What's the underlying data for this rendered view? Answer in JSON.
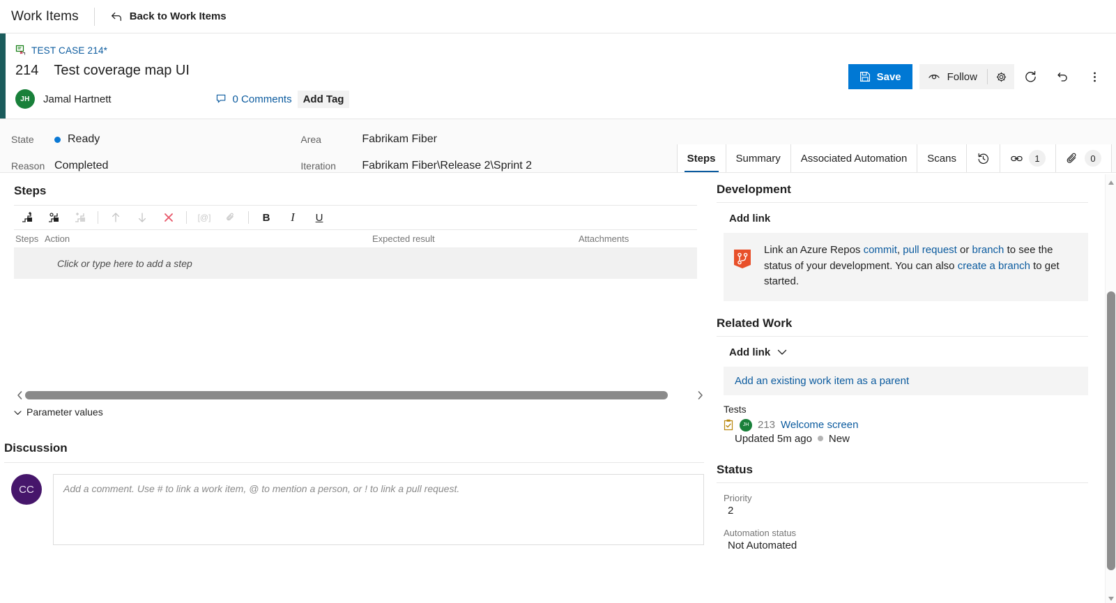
{
  "topbar": {
    "hub_title": "Work Items",
    "back_label": "Back to Work Items",
    "back_icon": "back-arrow-icon"
  },
  "work_item": {
    "type_breadcrumb": "TEST CASE 214*",
    "type_icon": "test-case-icon",
    "id": "214",
    "title": "Test coverage map UI",
    "assigned_to": "Jamal Hartnett",
    "assigned_to_initials": "JH",
    "comments_label": "0 Comments",
    "comments_icon": "comment-bubble-icon",
    "add_tag_label": "Add Tag"
  },
  "actions": {
    "save_label": "Save",
    "save_icon": "save-disk-icon",
    "follow_label": "Follow",
    "follow_icon": "eye-icon",
    "settings_icon": "gear-icon",
    "refresh_icon": "refresh-icon",
    "revert_icon": "undo-icon",
    "more_icon": "more-vertical-icon",
    "accent_color": "#0078d4"
  },
  "fields": {
    "state": {
      "label": "State",
      "value": "Ready",
      "dot_color": "#0a78d4"
    },
    "reason": {
      "label": "Reason",
      "value": "Completed"
    },
    "area": {
      "label": "Area",
      "value": "Fabrikam Fiber"
    },
    "iteration": {
      "label": "Iteration",
      "value": "Fabrikam Fiber\\Release 2\\Sprint 2"
    }
  },
  "tabs": [
    {
      "label": "Steps",
      "selected": true,
      "icon": "",
      "badge": ""
    },
    {
      "label": "Summary",
      "selected": false,
      "icon": "",
      "badge": ""
    },
    {
      "label": "Associated Automation",
      "selected": false,
      "icon": "",
      "badge": ""
    },
    {
      "label": "Scans",
      "selected": false,
      "icon": "",
      "badge": ""
    },
    {
      "label": "",
      "selected": false,
      "icon": "history-icon",
      "badge": ""
    },
    {
      "label": "",
      "selected": false,
      "icon": "link-icon",
      "badge": "1"
    },
    {
      "label": "",
      "selected": false,
      "icon": "paperclip-icon",
      "badge": "0"
    }
  ],
  "steps_section": {
    "heading": "Steps",
    "toolbar": [
      {
        "name": "insert-step-icon",
        "enabled": true
      },
      {
        "name": "insert-shared-steps-icon",
        "enabled": true
      },
      {
        "name": "create-shared-steps-icon",
        "enabled": false
      },
      {
        "name": "move-up-icon",
        "enabled": false
      },
      {
        "name": "move-down-icon",
        "enabled": false
      },
      {
        "name": "delete-icon",
        "enabled": true
      },
      {
        "name": "insert-parameter-icon",
        "enabled": false
      },
      {
        "name": "attach-file-icon",
        "enabled": false
      },
      {
        "name": "bold-icon",
        "enabled": true,
        "text": "B"
      },
      {
        "name": "italic-icon",
        "enabled": true,
        "text": "I"
      },
      {
        "name": "underline-icon",
        "enabled": true,
        "text": "U"
      }
    ],
    "columns": [
      "Steps",
      "Action",
      "Expected result",
      "Attachments"
    ],
    "empty_row_text": "Click or type here to add a step",
    "parameter_values_label": "Parameter values"
  },
  "discussion": {
    "heading": "Discussion",
    "avatar_initials": "CC",
    "comment_placeholder": "Add a comment. Use # to link a work item, @ to mention a person, or ! to link a pull request."
  },
  "development": {
    "heading": "Development",
    "add_link_label": "Add link",
    "callout_icon": "azure-repos-icon",
    "callout": {
      "text_1": "Link an Azure Repos ",
      "link_commit": "commit",
      "text_2": ", ",
      "link_pull_request": "pull request",
      "text_3": " or ",
      "link_branch": "branch",
      "text_4": " to see the status of your development. You can also ",
      "link_create_branch": "create a branch",
      "text_5": " to get started."
    }
  },
  "related_work": {
    "heading": "Related Work",
    "add_link_label": "Add link",
    "add_link_chevron": "chevron-down-icon",
    "add_parent_link": "Add an existing work item as a parent",
    "tests_label": "Tests",
    "items": [
      {
        "icon": "test-case-clipboard-icon",
        "avatar_initials": "JH",
        "id": "213",
        "title": "Welcome screen",
        "updated": "Updated 5m ago",
        "state": "New",
        "state_dot_color": "#b3b3b3"
      }
    ]
  },
  "status": {
    "heading": "Status",
    "fields": [
      {
        "label": "Priority",
        "value": "2"
      },
      {
        "label": "Automation status",
        "value": "Not Automated"
      }
    ]
  },
  "scrollbars": {
    "horizontal_left_arrow": "scroll-left-arrow-icon",
    "horizontal_right_arrow": "scroll-right-arrow-icon",
    "vertical_up_arrow": "scroll-up-arrow-icon",
    "vertical_down_arrow": "scroll-down-arrow-icon"
  }
}
